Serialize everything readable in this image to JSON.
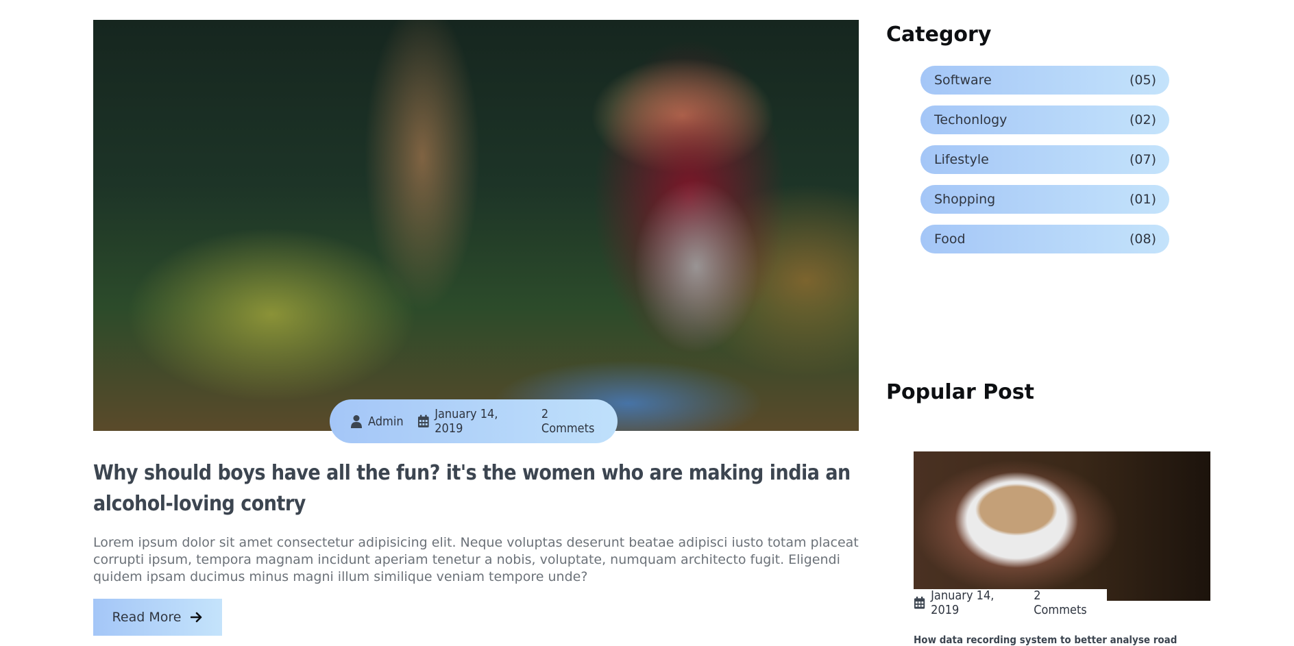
{
  "main_post": {
    "meta": {
      "author": "Admin",
      "date": "January 14, 2019",
      "comments": "2 Commets"
    },
    "title": "Why should boys have all the fun? it's the women who are making india an alcohol-loving contry",
    "excerpt": "Lorem ipsum dolor sit amet consectetur adipisicing elit. Neque voluptas deserunt beatae adipisci iusto totam placeat corrupti ipsum, tempora magnam incidunt aperiam tenetur a nobis, voluptate, numquam architecto fugit. Eligendi quidem ipsam ducimus minus magni illum similique veniam tempore unde?",
    "read_more": "Read More"
  },
  "sidebar": {
    "category_title": "Category",
    "categories": [
      {
        "name": "Software",
        "count": "(05)"
      },
      {
        "name": "Techonlogy",
        "count": "(02)"
      },
      {
        "name": "Lifestyle",
        "count": "(07)"
      },
      {
        "name": "Shopping",
        "count": "(01)"
      },
      {
        "name": "Food",
        "count": "(08)"
      }
    ],
    "popular_title": "Popular Post",
    "popular_post": {
      "date": "January 14, 2019",
      "comments": "2 Commets",
      "title": "How data recording system to better analyse road"
    }
  },
  "colors": {
    "pill_gradient_start": "#a4c6f7",
    "pill_gradient_end": "#c4e3fb",
    "heading": "#0d0f12",
    "text": "#3c4550"
  },
  "icons": [
    "user-icon",
    "calendar-icon",
    "arrow-right-icon"
  ]
}
